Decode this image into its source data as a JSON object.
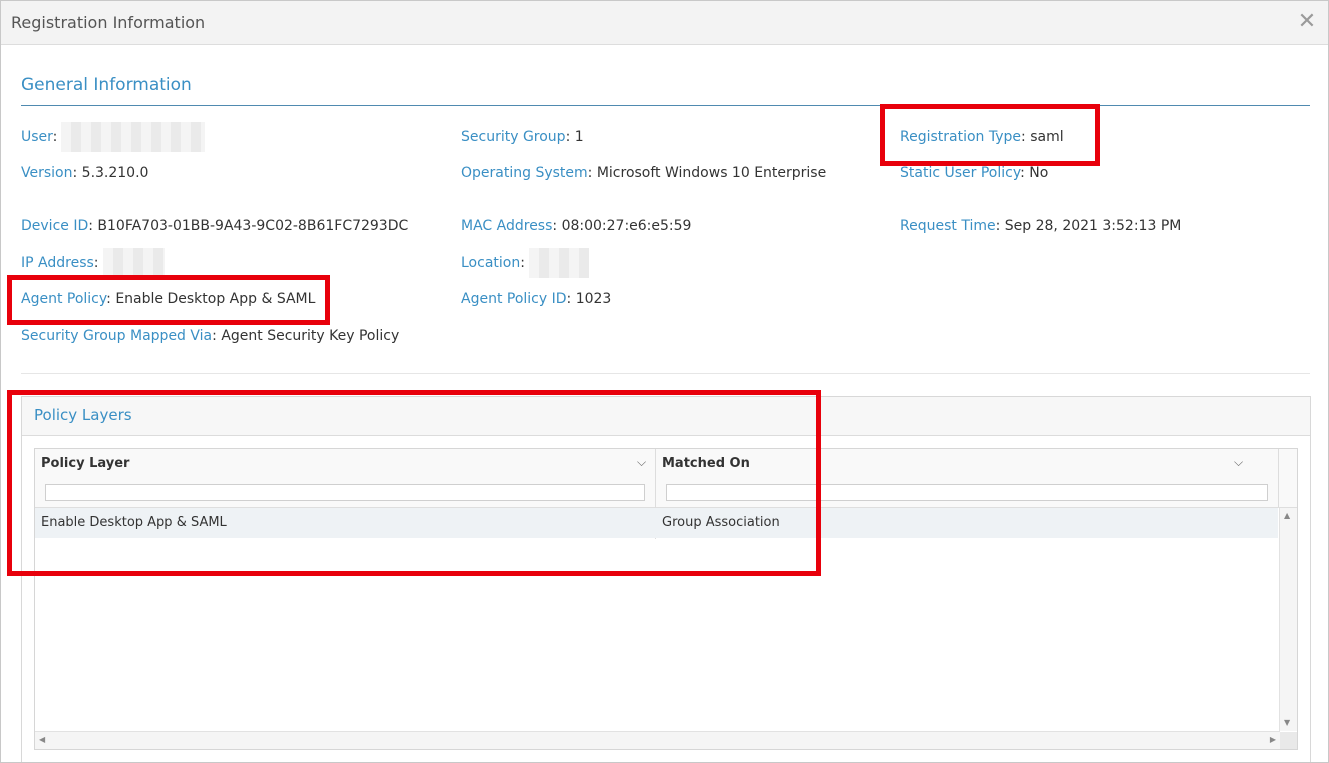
{
  "dialog": {
    "title": "Registration Information",
    "close_glyph": "✕"
  },
  "general": {
    "heading": "General Information",
    "fields": {
      "user": {
        "label": "User",
        "value": ""
      },
      "version": {
        "label": "Version",
        "value": "5.3.210.0"
      },
      "device_id": {
        "label": "Device ID",
        "value": "B10FA703-01BB-9A43-9C02-8B61FC7293DC"
      },
      "ip_address": {
        "label": "IP Address",
        "value": ""
      },
      "agent_policy": {
        "label": "Agent Policy",
        "value": "Enable Desktop App & SAML"
      },
      "security_group_mapped_via": {
        "label": "Security Group Mapped Via",
        "value": "Agent Security Key Policy"
      },
      "security_group": {
        "label": "Security Group",
        "value": "1"
      },
      "operating_system": {
        "label": "Operating System",
        "value": "Microsoft Windows 10 Enterprise"
      },
      "mac_address": {
        "label": "MAC Address",
        "value": "08:00:27:e6:e5:59"
      },
      "location": {
        "label": "Location",
        "value": ""
      },
      "agent_policy_id": {
        "label": "Agent Policy ID",
        "value": "1023"
      },
      "registration_type": {
        "label": "Registration Type",
        "value": "saml"
      },
      "static_user_policy": {
        "label": "Static User Policy",
        "value": "No"
      },
      "request_time": {
        "label": "Request Time",
        "value": "Sep 28, 2021 3:52:13 PM"
      }
    }
  },
  "policy_layers": {
    "heading": "Policy Layers",
    "columns": [
      "Policy Layer",
      "Matched On"
    ],
    "rows": [
      [
        "Enable Desktop App & SAML",
        "Group Association"
      ]
    ]
  },
  "colors": {
    "label": "#3a8fc4",
    "highlight": "#e8000b"
  }
}
